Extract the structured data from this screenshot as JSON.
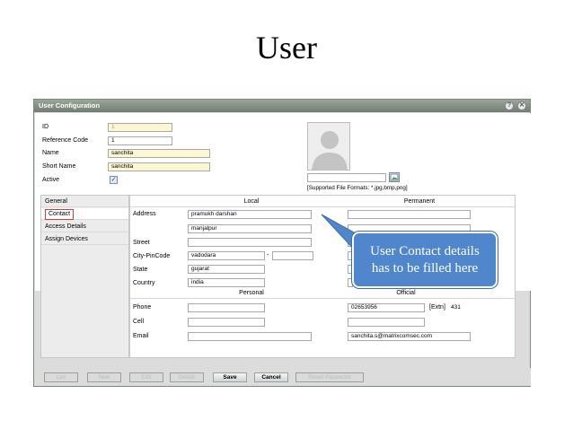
{
  "slide": {
    "title": "User"
  },
  "window": {
    "title": "User Configuration",
    "help_icon": "?",
    "close_icon": "✕"
  },
  "fields": {
    "id": {
      "label": "ID",
      "value": "1"
    },
    "reference_code": {
      "label": "Reference Code",
      "value": "1"
    },
    "name": {
      "label": "Name",
      "value": "sanchita"
    },
    "short_name": {
      "label": "Short Name",
      "value": "sanchita"
    },
    "active": {
      "label": "Active",
      "checked": true,
      "mark": "✓"
    }
  },
  "photo": {
    "supported_formats": "[Supported File Formats: *.jpg,bmp,png]"
  },
  "nav": {
    "items": [
      {
        "label": "General"
      },
      {
        "label": "Contact"
      },
      {
        "label": "Access Details"
      },
      {
        "label": "Assign Devices"
      }
    ]
  },
  "contact": {
    "local_header": "Local",
    "permanent_header": "Permanent",
    "personal_header": "Personal",
    "official_header": "Official",
    "address_label": "Address",
    "address_line1": "pramukh darshan",
    "address_line2": "manjalpur",
    "street_label": "Street",
    "street_value": "",
    "city_pincode_label": "City-PinCode",
    "city_value": "vadodara",
    "pin_separator": "-",
    "pin_value": "",
    "state_label": "State",
    "state_value": "gujarat",
    "country_label": "Country",
    "country_value": "india",
    "phone_label": "Phone",
    "phone_personal": "",
    "phone_official": "02653956",
    "extn_label": "[Extn]",
    "extn_value": "431",
    "cell_label": "Cell",
    "cell_personal": "",
    "cell_official": "",
    "email_label": "Email",
    "email_personal": "",
    "email_official": "sanchita.s@matrixcomsec.com"
  },
  "callout": {
    "line1": "User  Contact details",
    "line2": "has to be filled here"
  },
  "buttons": {
    "list": "List",
    "new": "New",
    "edit": "Edit",
    "delete": "Delete",
    "save": "Save",
    "cancel": "Cancel",
    "reset_password": "Reset Password"
  }
}
